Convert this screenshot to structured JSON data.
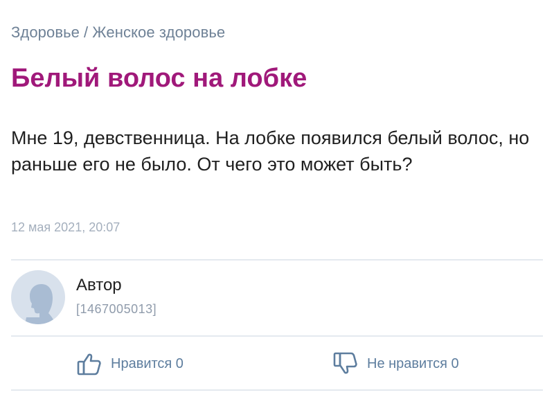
{
  "breadcrumb": {
    "category": "Здоровье",
    "separator": "/",
    "subcategory": "Женское здоровье"
  },
  "question": {
    "title": "Белый волос на лобке",
    "text": "Мне 19, девственница. На лобке появился белый волос, но раньше его не было. От чего это может быть?",
    "date": "12 мая 2021, 20:07"
  },
  "author": {
    "name": "Автор",
    "id": "[1467005013]",
    "avatar_icon": "user-silhouette-icon"
  },
  "votes": {
    "like_label": "Нравится 0",
    "dislike_label": "Не нравится 0",
    "like_icon": "thumbs-up-icon",
    "dislike_icon": "thumbs-down-icon"
  },
  "colors": {
    "title": "#a0197a",
    "breadcrumb": "#6e8196",
    "vote": "#5d7d9e",
    "avatar_bg": "#d8e1ec",
    "avatar_figure": "#a9bcd3",
    "divider": "#e4e9ef"
  }
}
